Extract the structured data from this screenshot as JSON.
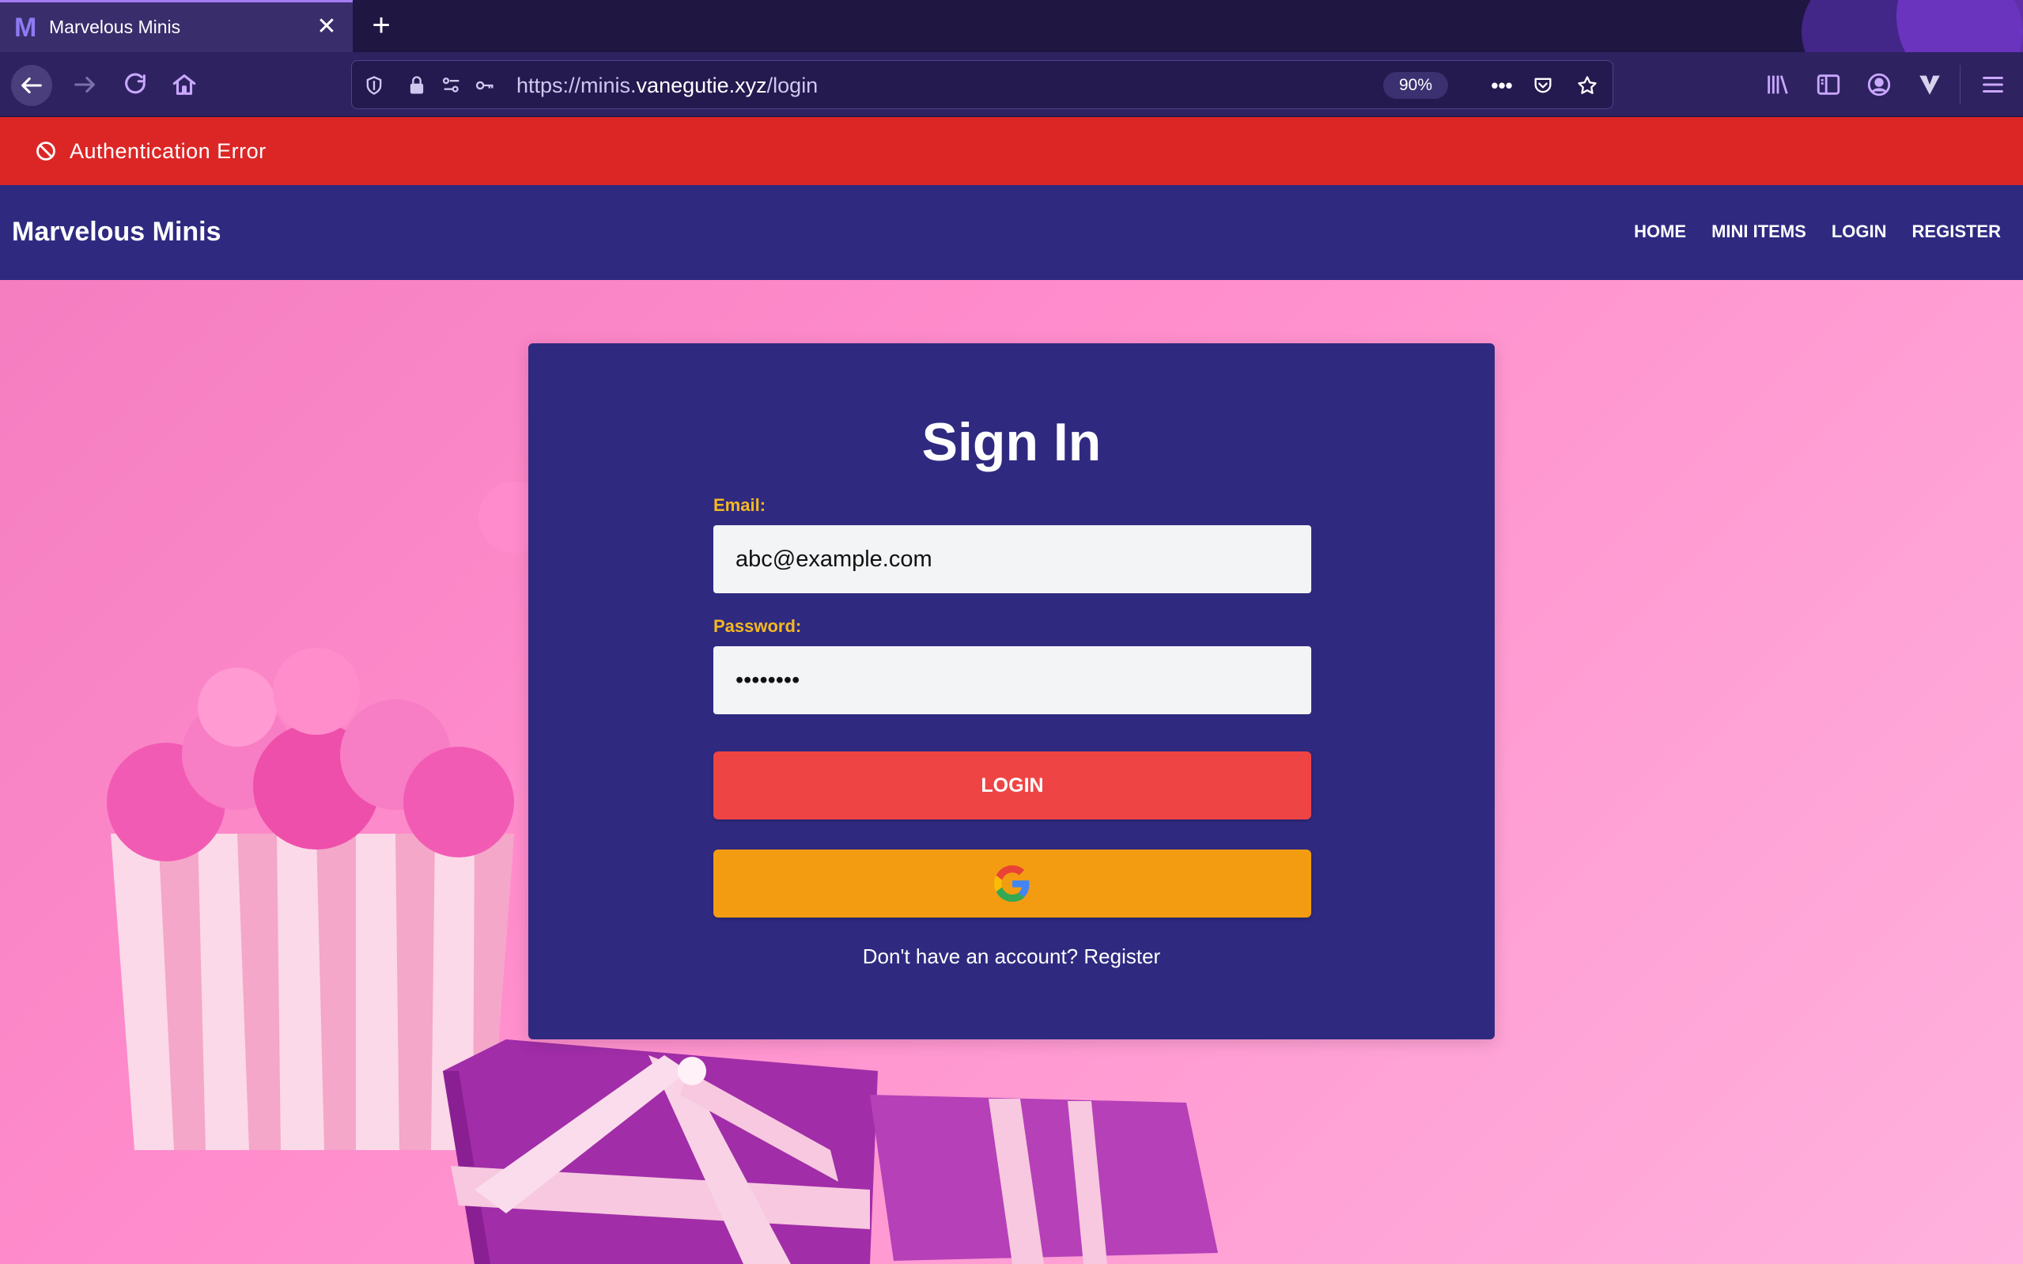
{
  "browser": {
    "tab": {
      "favicon": "M",
      "title": "Marvelous Minis",
      "close": "✕"
    },
    "new_tab": "+",
    "url": {
      "prefix": "https://minis.",
      "host": "vanegutie.xyz",
      "path": "/login"
    },
    "zoom": "90%",
    "more": "•••"
  },
  "alert": {
    "text": "Authentication Error",
    "icon": "prohibited-icon",
    "color": "#dc2626"
  },
  "header": {
    "brand": "Marvelous Minis",
    "menu": [
      "HOME",
      "MINI ITEMS",
      "LOGIN",
      "REGISTER"
    ]
  },
  "form": {
    "title": "Sign In",
    "email_label": "Email:",
    "email_value": "abc@example.com",
    "password_label": "Password:",
    "password_value": "password",
    "login_button": "LOGIN",
    "google_icon": "google-logo-icon",
    "register_prompt": "Don't have an account?",
    "register_link": "Register"
  },
  "colors": {
    "header_bg": "#2f2a80",
    "card_bg": "#2f2a80",
    "label": "#f5b820",
    "login_btn": "#ef4444",
    "google_btn": "#f39c12",
    "page_bg": "#ff8ccc"
  }
}
